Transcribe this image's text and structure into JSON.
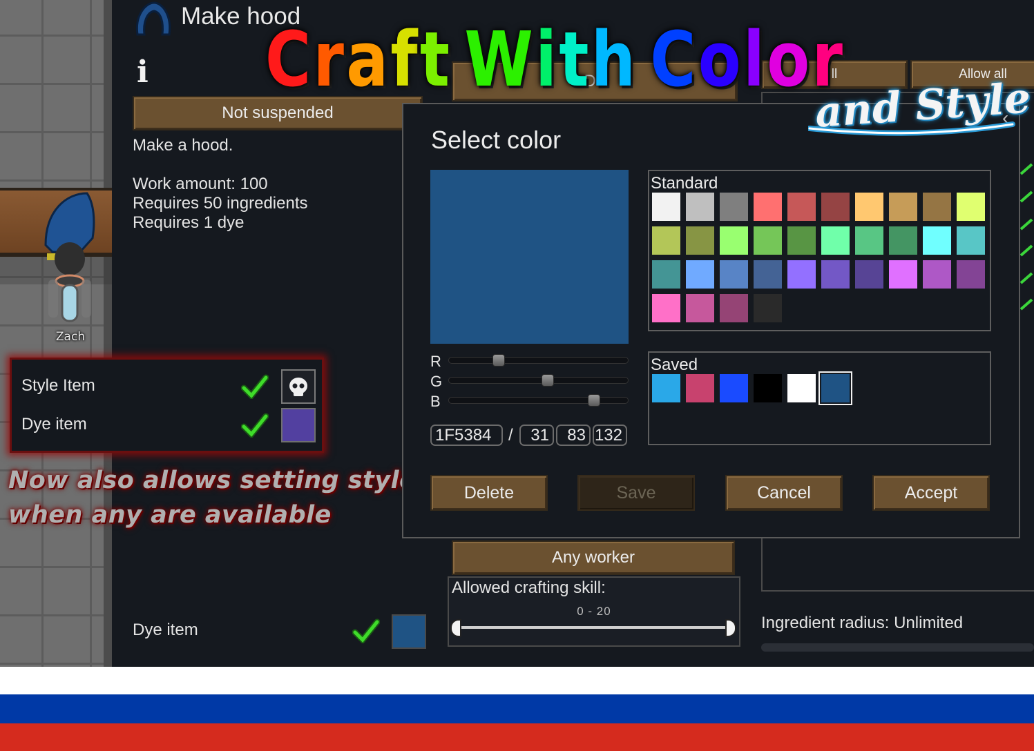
{
  "bill": {
    "title": "Make hood",
    "info_icon_glyph": "i",
    "suspend_button": "Not suspended",
    "description": "Make a hood.",
    "work_amount": "Work amount: 100",
    "ingredients": "Requires 50 ingredients",
    "dye": "Requires 1 dye",
    "icon": "hood-icon"
  },
  "top_controls": {
    "left_button_partial": "Do",
    "clear_partial": "ll",
    "allow_all": "Allow all"
  },
  "worker": {
    "button": "Any worker",
    "skill_label": "Allowed crafting skill:",
    "skill_range": "0 - 20"
  },
  "ingredient_radius": "Ingredient radius: Unlimited",
  "bottom_dye": {
    "label": "Dye item",
    "color": "#1F5384"
  },
  "pawn": {
    "name": "Zach"
  },
  "style_popup": {
    "style_label": "Style Item",
    "dye_label": "Dye item",
    "style_icon": "skull-icon",
    "dye_color": "#5240A0"
  },
  "promo": {
    "line1": "Now also allows setting style",
    "line2": "when any are available"
  },
  "title_art": {
    "letters": [
      "C",
      "r",
      "a",
      "f",
      "t",
      " ",
      "W",
      "i",
      "t",
      "h",
      " ",
      "C",
      "o",
      "l",
      "o",
      "r"
    ],
    "colors": [
      "#ff1a1a",
      "#ff5a00",
      "#ff9a00",
      "#d7e000",
      "#7cf000",
      "",
      "#2cf000",
      "#00f06a",
      "#00f0c8",
      "#00b8ff",
      "",
      "#0040ff",
      "#2a00ff",
      "#8a00ff",
      "#e000e0",
      "#ff0080"
    ],
    "script": "and Style"
  },
  "dialog": {
    "title": "Select color",
    "close_glyph": "‹",
    "preview_color": "#1F5384",
    "channels": [
      {
        "label": "R",
        "value": 31
      },
      {
        "label": "G",
        "value": 83
      },
      {
        "label": "B",
        "value": 132
      }
    ],
    "hex": "1F5384",
    "slash": "/",
    "rgb_fields": [
      "31",
      "83",
      "132"
    ],
    "standard_label": "Standard",
    "standard_colors": [
      "#F2F2F2",
      "#BFBFBF",
      "#7F7F7F",
      "#FF7070",
      "#C65858",
      "#954444",
      "#FFC870",
      "#C69C58",
      "#957544",
      "#E0FF70",
      "#B3C658",
      "#879544",
      "#99FF70",
      "#75C658",
      "#589544",
      "#70FFAA",
      "#58C684",
      "#449563",
      "#70FFFF",
      "#58C6C6",
      "#449595",
      "#70AAFF",
      "#5884C6",
      "#446395",
      "#9370FF",
      "#7358C6",
      "#574495",
      "#E070FF",
      "#AE58C6",
      "#834495",
      "#FF70C8",
      "#C6589C",
      "#954475",
      "#2A2A2A"
    ],
    "saved_label": "Saved",
    "saved_colors": [
      "#2AA8E8",
      "#C8426E",
      "#1A4BFF",
      "#000000",
      "#FFFFFF",
      "#1F5384"
    ],
    "buttons": {
      "delete": "Delete",
      "save": "Save",
      "cancel": "Cancel",
      "accept": "Accept"
    }
  },
  "flag": {
    "stripes": [
      "#FFFFFF",
      "#0039A6",
      "#D52B1E"
    ]
  }
}
